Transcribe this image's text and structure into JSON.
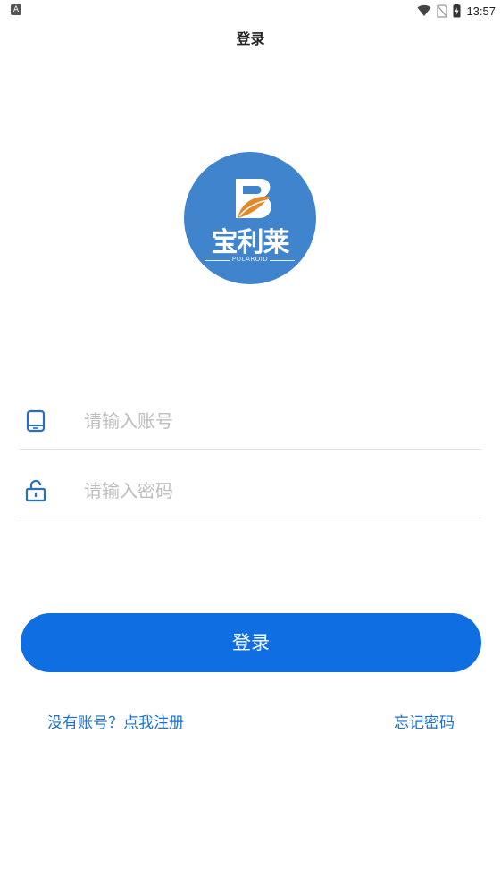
{
  "status_bar": {
    "app_icon_letter": "A",
    "wifi_icon": "wifi-icon",
    "sim_icon": "no-sim-icon",
    "battery_icon": "battery-icon",
    "time": "13:57"
  },
  "header": {
    "title": "登录"
  },
  "logo": {
    "text": "宝利莱",
    "sub_text": "POLAROID",
    "color": "#3f84cc"
  },
  "form": {
    "account": {
      "icon": "phone-icon",
      "placeholder": "请输入账号",
      "value": ""
    },
    "password": {
      "icon": "lock-icon",
      "placeholder": "请输入密码",
      "value": ""
    }
  },
  "actions": {
    "login_label": "登录",
    "register_link": "没有账号？点我注册",
    "forgot_link": "忘记密码"
  },
  "colors": {
    "accent": "#0f6ee2",
    "link": "#1a6fcf",
    "placeholder": "#bdbdbd",
    "divider": "#e2e2e2"
  }
}
